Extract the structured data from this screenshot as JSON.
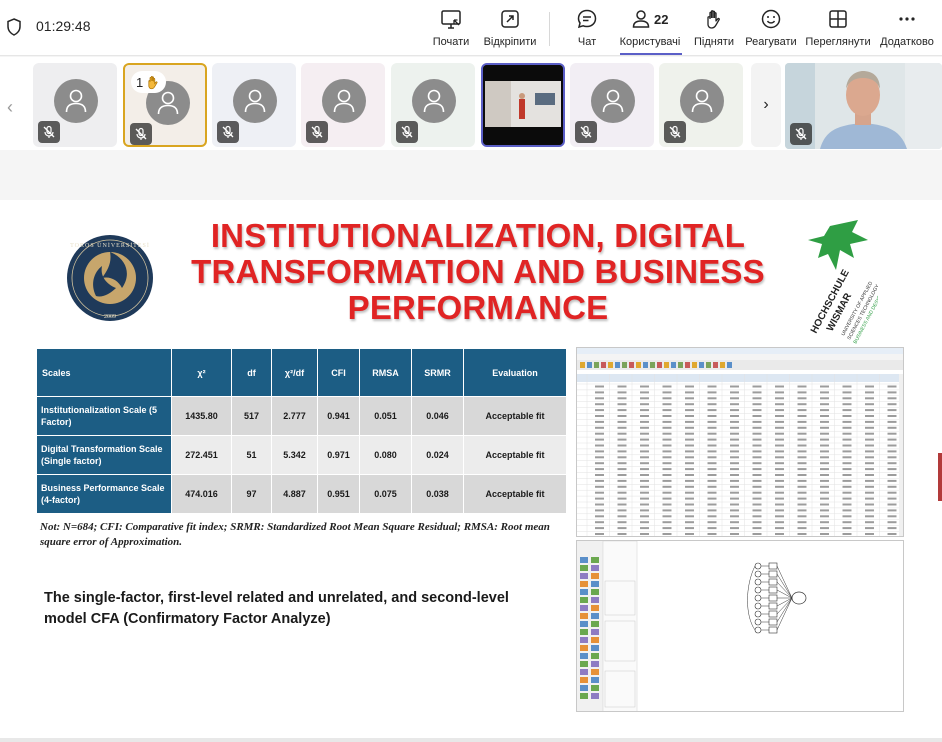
{
  "meeting": {
    "elapsed_time": "01:29:48"
  },
  "toolbar": {
    "start_label": "Почати",
    "popout_label": "Відкріпити",
    "chat_label": "Чат",
    "people_label": "Користувачі",
    "people_count": "22",
    "raise_label": "Підняти",
    "react_label": "Реагувати",
    "view_label": "Переглянути",
    "more_label": "Додатково"
  },
  "participants": {
    "raised_hand_order": "1",
    "tiles": [
      {
        "kind": "avatar",
        "muted": true,
        "bg": "#eeeef0"
      },
      {
        "kind": "avatar",
        "muted": true,
        "bg": "#f3eee8",
        "raised_hand": true,
        "border": "#d9a520"
      },
      {
        "kind": "avatar",
        "muted": true,
        "bg": "#eef0f5"
      },
      {
        "kind": "avatar",
        "muted": true,
        "bg": "#f5eef2"
      },
      {
        "kind": "avatar",
        "muted": true,
        "bg": "#edf2ee"
      },
      {
        "kind": "video",
        "muted": false
      },
      {
        "kind": "avatar",
        "muted": true,
        "bg": "#f2eef4"
      },
      {
        "kind": "avatar",
        "muted": true,
        "bg": "#eff2ec"
      }
    ],
    "speaker_muted": true
  },
  "slide": {
    "title": "INSTITUTIONALIZATION, DIGITAL TRANSFORMATION AND BUSINESS PERFORMANCE",
    "logo_left_text": "TOROS ÜNİVERSİTESİ",
    "logo_left_year": "2009",
    "logo_right_text": "HOCHSCHULE WISMAR",
    "logo_right_sub": "UNIVERSITY OF APPLIED SCIENCES TECHNOLOGY, BUSINESS AND DESIGN",
    "table": {
      "headers": [
        "Scales",
        "χ²",
        "df",
        "χ²/df",
        "CFI",
        "RMSA",
        "SRMR",
        "Evaluation"
      ],
      "rows": [
        [
          "Institutionalization Scale (5 Factor)",
          "1435.80",
          "517",
          "2.777",
          "0.941",
          "0.051",
          "0.046",
          "Acceptable fit"
        ],
        [
          "Digital Transformation Scale (Single factor)",
          "272.451",
          "51",
          "5.342",
          "0.971",
          "0.080",
          "0.024",
          "Acceptable fit"
        ],
        [
          "Business Performance Scale (4-factor)",
          "474.016",
          "97",
          "4.887",
          "0.951",
          "0.075",
          "0.038",
          "Acceptable fit"
        ]
      ]
    },
    "note": "Not: N=684; CFI: Comparative fit index; SRMR: Standardized Root Mean Square Residual; RMSA: Root mean square error of Approximation.",
    "description": "The single-factor, first-level related and unrelated, and second-level model CFA (Confirmatory Factor Analyze)",
    "colors": {
      "title": "#e02424",
      "table_header": "#1c5d84"
    }
  }
}
